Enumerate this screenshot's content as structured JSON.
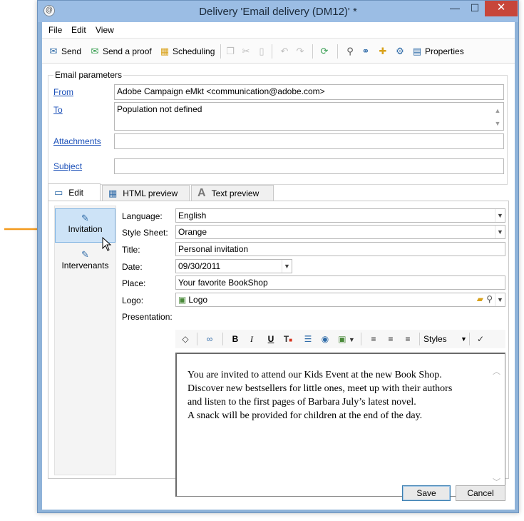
{
  "window": {
    "title": "Delivery 'Email delivery (DM12)' *",
    "app_icon": "@",
    "min_glyph": "—",
    "max_glyph": "☐",
    "close_glyph": "✕"
  },
  "menu": {
    "items": [
      "File",
      "Edit",
      "View"
    ]
  },
  "toolbar": {
    "send": "Send",
    "send_proof": "Send a proof",
    "scheduling": "Scheduling",
    "properties": "Properties"
  },
  "email_params": {
    "group_label": "Email parameters",
    "from_label": "From",
    "from_value": "Adobe Campaign eMkt <communication@adobe.com>",
    "to_label": "To",
    "to_value": "Population not defined",
    "attachments_label": "Attachments",
    "attachments_value": "",
    "subject_label": "Subject",
    "subject_value": ""
  },
  "tabs": [
    {
      "label": "Edit",
      "active": true
    },
    {
      "label": "HTML preview",
      "active": false
    },
    {
      "label": "Text preview",
      "active": false
    }
  ],
  "left_list": [
    {
      "label": "Invitation",
      "selected": true
    },
    {
      "label": "Intervenants",
      "selected": false
    }
  ],
  "properties": {
    "language_label": "Language:",
    "language_value": "English",
    "stylesheet_label": "Style Sheet:",
    "stylesheet_value": "Orange",
    "title_label": "Title:",
    "title_value": "Personal invitation",
    "date_label": "Date:",
    "date_value": "09/30/2011",
    "place_label": "Place:",
    "place_value": "Your favorite BookShop",
    "logo_label": "Logo:",
    "logo_value": "Logo",
    "presentation_label": "Presentation:"
  },
  "editor_toolbar": {
    "bold": "B",
    "italic": "I",
    "underline": "U",
    "styles": "Styles"
  },
  "editor": {
    "lines": [
      "You are invited to attend our Kids Event at the new Book Shop.",
      "Discover new bestsellers for little ones, meet up with their authors",
      "and listen to the first pages of Barbara July’s latest novel.",
      "A snack will be provided for children at the end of the day."
    ]
  },
  "buttons": {
    "save": "Save",
    "cancel": "Cancel"
  },
  "colors": {
    "accent_arrow": "#f39a1e",
    "link": "#1a4fb8",
    "close": "#c7463a",
    "titlebar": "#9bbde4"
  }
}
